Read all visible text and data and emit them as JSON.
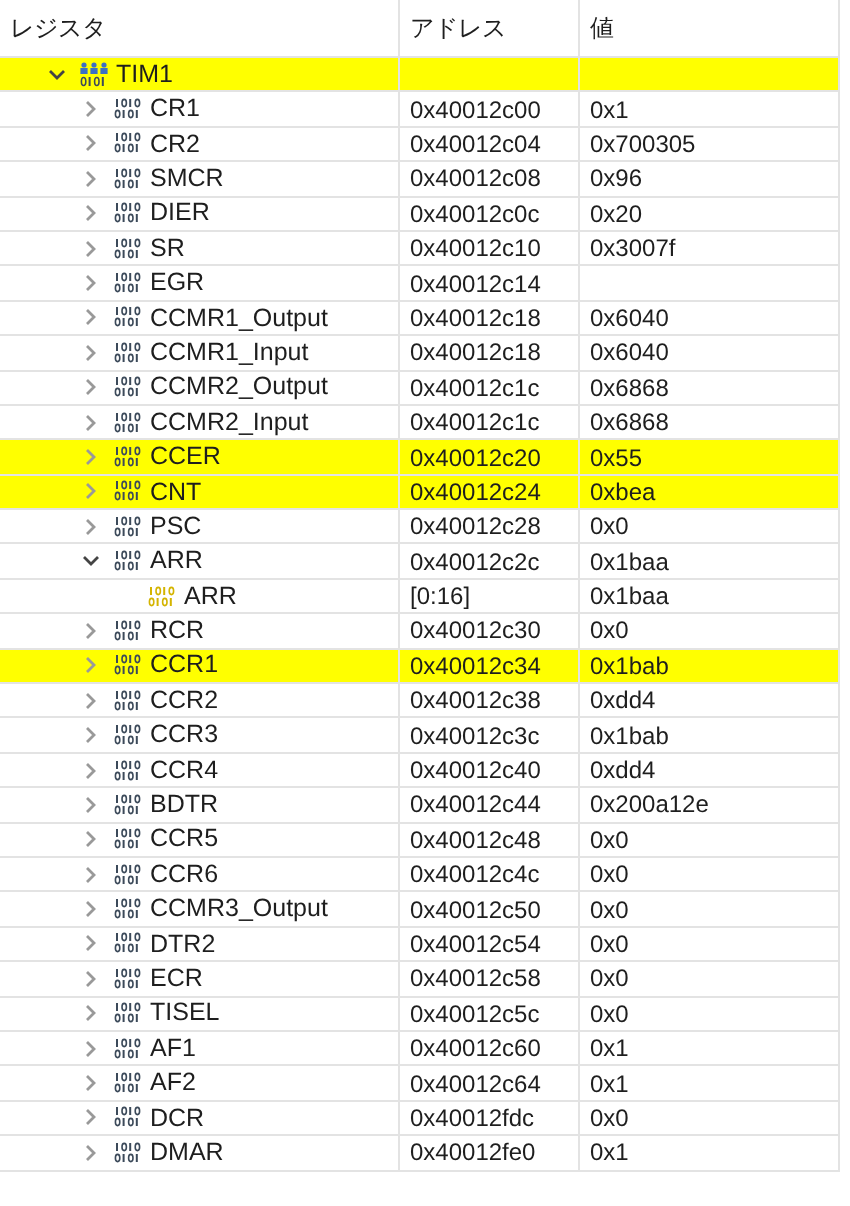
{
  "columns": [
    "レジスタ",
    "アドレス",
    "値"
  ],
  "tree": [
    {
      "kind": "peripheral",
      "name": "TIM1",
      "highlighted": true,
      "expanded": true,
      "children": [
        {
          "kind": "register",
          "name": "CR1",
          "address": "0x40012c00",
          "value": "0x1",
          "highlighted": false,
          "expanded": false
        },
        {
          "kind": "register",
          "name": "CR2",
          "address": "0x40012c04",
          "value": "0x700305",
          "highlighted": false,
          "expanded": false
        },
        {
          "kind": "register",
          "name": "SMCR",
          "address": "0x40012c08",
          "value": "0x96",
          "highlighted": false,
          "expanded": false
        },
        {
          "kind": "register",
          "name": "DIER",
          "address": "0x40012c0c",
          "value": "0x20",
          "highlighted": false,
          "expanded": false
        },
        {
          "kind": "register",
          "name": "SR",
          "address": "0x40012c10",
          "value": "0x3007f",
          "highlighted": false,
          "expanded": false
        },
        {
          "kind": "register",
          "name": "EGR",
          "address": "0x40012c14",
          "highlighted": false,
          "expanded": false
        },
        {
          "kind": "register",
          "name": "CCMR1_Output",
          "address": "0x40012c18",
          "value": "0x6040",
          "highlighted": false,
          "expanded": false
        },
        {
          "kind": "register",
          "name": "CCMR1_Input",
          "address": "0x40012c18",
          "value": "0x6040",
          "highlighted": false,
          "expanded": false
        },
        {
          "kind": "register",
          "name": "CCMR2_Output",
          "address": "0x40012c1c",
          "value": "0x6868",
          "highlighted": false,
          "expanded": false
        },
        {
          "kind": "register",
          "name": "CCMR2_Input",
          "address": "0x40012c1c",
          "value": "0x6868",
          "highlighted": false,
          "expanded": false
        },
        {
          "kind": "register",
          "name": "CCER",
          "address": "0x40012c20",
          "value": "0x55",
          "highlighted": true,
          "expanded": false
        },
        {
          "kind": "register",
          "name": "CNT",
          "address": "0x40012c24",
          "value": "0xbea",
          "highlighted": true,
          "expanded": false
        },
        {
          "kind": "register",
          "name": "PSC",
          "address": "0x40012c28",
          "value": "0x0",
          "highlighted": false,
          "expanded": false
        },
        {
          "kind": "register",
          "name": "ARR",
          "address": "0x40012c2c",
          "value": "0x1baa",
          "highlighted": false,
          "expanded": true,
          "children": [
            {
              "kind": "field",
              "name": "ARR",
              "address": "[0:16]",
              "value": "0x1baa",
              "highlighted": false
            }
          ]
        },
        {
          "kind": "register",
          "name": "RCR",
          "address": "0x40012c30",
          "value": "0x0",
          "highlighted": false,
          "expanded": false
        },
        {
          "kind": "register",
          "name": "CCR1",
          "address": "0x40012c34",
          "value": "0x1bab",
          "highlighted": true,
          "expanded": false
        },
        {
          "kind": "register",
          "name": "CCR2",
          "address": "0x40012c38",
          "value": "0xdd4",
          "highlighted": false,
          "expanded": false
        },
        {
          "kind": "register",
          "name": "CCR3",
          "address": "0x40012c3c",
          "value": "0x1bab",
          "highlighted": false,
          "expanded": false
        },
        {
          "kind": "register",
          "name": "CCR4",
          "address": "0x40012c40",
          "value": "0xdd4",
          "highlighted": false,
          "expanded": false
        },
        {
          "kind": "register",
          "name": "BDTR",
          "address": "0x40012c44",
          "value": "0x200a12e",
          "highlighted": false,
          "expanded": false
        },
        {
          "kind": "register",
          "name": "CCR5",
          "address": "0x40012c48",
          "value": "0x0",
          "highlighted": false,
          "expanded": false
        },
        {
          "kind": "register",
          "name": "CCR6",
          "address": "0x40012c4c",
          "value": "0x0",
          "highlighted": false,
          "expanded": false
        },
        {
          "kind": "register",
          "name": "CCMR3_Output",
          "address": "0x40012c50",
          "value": "0x0",
          "highlighted": false,
          "expanded": false
        },
        {
          "kind": "register",
          "name": "DTR2",
          "address": "0x40012c54",
          "value": "0x0",
          "highlighted": false,
          "expanded": false
        },
        {
          "kind": "register",
          "name": "ECR",
          "address": "0x40012c58",
          "value": "0x0",
          "highlighted": false,
          "expanded": false
        },
        {
          "kind": "register",
          "name": "TISEL",
          "address": "0x40012c5c",
          "value": "0x0",
          "highlighted": false,
          "expanded": false
        },
        {
          "kind": "register",
          "name": "AF1",
          "address": "0x40012c60",
          "value": "0x1",
          "highlighted": false,
          "expanded": false
        },
        {
          "kind": "register",
          "name": "AF2",
          "address": "0x40012c64",
          "value": "0x1",
          "highlighted": false,
          "expanded": false
        },
        {
          "kind": "register",
          "name": "DCR",
          "address": "0x40012fdc",
          "value": "0x0",
          "highlighted": false,
          "expanded": false
        },
        {
          "kind": "register",
          "name": "DMAR",
          "address": "0x40012fe0",
          "value": "0x1",
          "highlighted": false,
          "expanded": false
        }
      ]
    }
  ]
}
